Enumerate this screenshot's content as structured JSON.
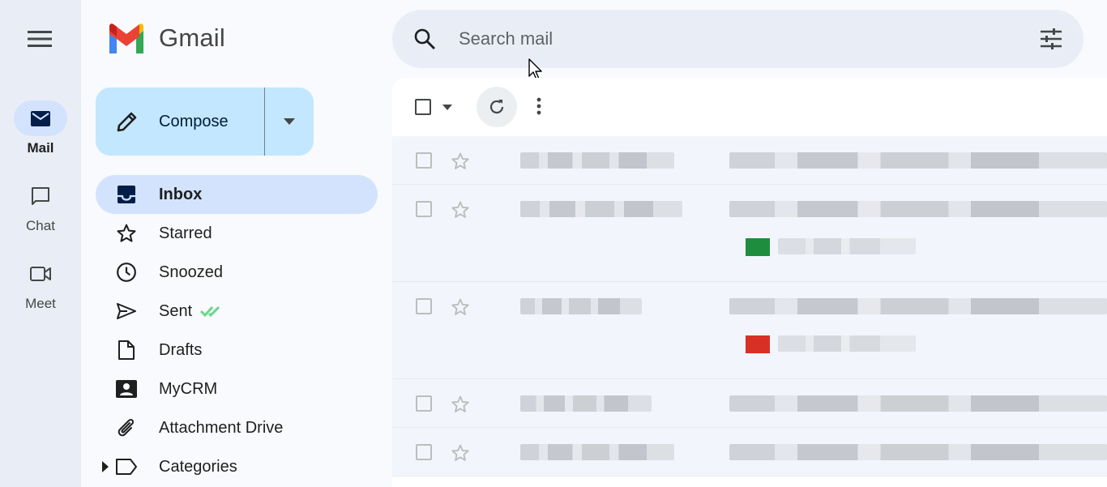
{
  "app": {
    "name": "Gmail"
  },
  "rail": {
    "items": [
      {
        "label": "Mail",
        "icon": "mail-icon",
        "active": true
      },
      {
        "label": "Chat",
        "icon": "chat-icon",
        "active": false
      },
      {
        "label": "Meet",
        "icon": "video-icon",
        "active": false
      }
    ]
  },
  "compose": {
    "label": "Compose"
  },
  "nav": {
    "items": [
      {
        "label": "Inbox",
        "icon": "inbox-icon",
        "active": true
      },
      {
        "label": "Starred",
        "icon": "star-icon"
      },
      {
        "label": "Snoozed",
        "icon": "clock-icon"
      },
      {
        "label": "Sent",
        "icon": "send-icon"
      },
      {
        "label": "Drafts",
        "icon": "draft-icon"
      },
      {
        "label": "MyCRM",
        "icon": "contact-card-icon"
      },
      {
        "label": "Attachment Drive",
        "icon": "paperclip-icon"
      },
      {
        "label": "Categories",
        "icon": "label-icon"
      }
    ]
  },
  "search": {
    "placeholder": "Search mail"
  },
  "colors": {
    "accent": "#d3e3fd",
    "compose": "#c2e7ff",
    "gmail_red": "#ea4335",
    "gmail_blue": "#4285f4",
    "gmail_green": "#34a853",
    "gmail_yellow": "#fbbc04",
    "sent_check": "#6dd58c",
    "chip_green": "#1e8e3e",
    "chip_red": "#d93025"
  }
}
